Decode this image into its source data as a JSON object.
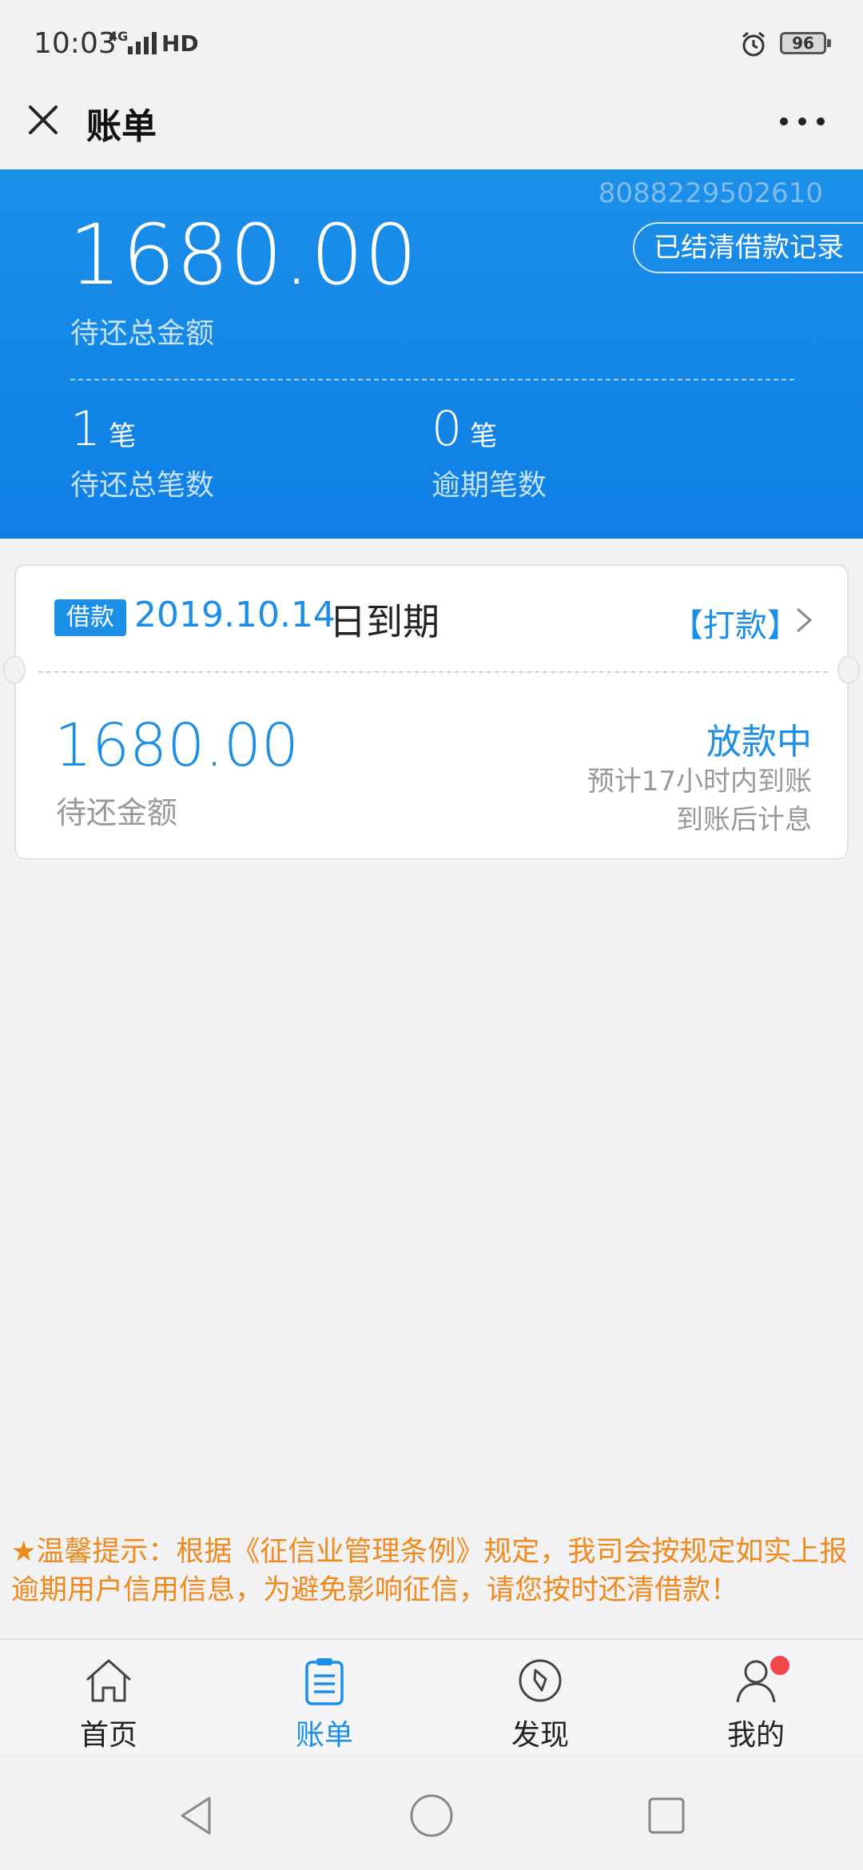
{
  "status_bar": {
    "time": "10:03",
    "network": "4G",
    "hd": "HD",
    "battery": "96"
  },
  "header": {
    "title": "账单"
  },
  "summary": {
    "account_no": "8088229502610",
    "settled_button": "已结清借款记录",
    "total_amount": "1680.00",
    "total_label": "待还总金额",
    "pending_count": "1",
    "pending_unit": "笔",
    "pending_label": "待还总笔数",
    "overdue_count": "0",
    "overdue_unit": "笔",
    "overdue_label": "逾期笔数"
  },
  "loan": {
    "tag": "借款",
    "due_date": "2019.10.14",
    "due_suffix": "日到期",
    "pay_label": "【打款】",
    "amount": "1680.00",
    "amount_label": "待还金额",
    "status": "放款中",
    "eta": "预计17小时内到账",
    "interest_note": "到账后计息"
  },
  "notice": "★温馨提示：根据《征信业管理条例》规定，我司会按规定如实上报逾期用户信用信息，为避免影响征信，请您按时还清借款！",
  "tabs": [
    {
      "label": "首页",
      "icon": "home-icon",
      "active": false
    },
    {
      "label": "账单",
      "icon": "bill-icon",
      "active": true
    },
    {
      "label": "发现",
      "icon": "compass-icon",
      "active": false
    },
    {
      "label": "我的",
      "icon": "user-icon",
      "active": false,
      "badge": true
    }
  ],
  "colors": {
    "primary": "#1b8fe8",
    "notice": "#f08a1d",
    "badge": "#f4474c"
  }
}
